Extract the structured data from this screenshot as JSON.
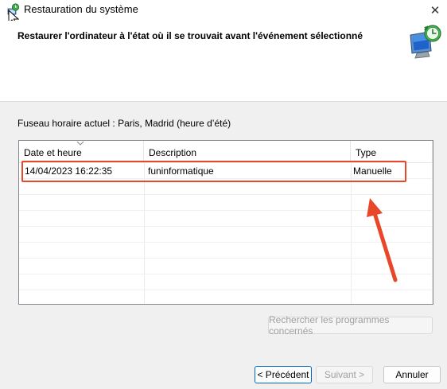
{
  "window": {
    "title": "Restauration du système"
  },
  "header": {
    "title": "Restaurer l'ordinateur à l'état où il se trouvait avant l'événement sélectionné"
  },
  "timezone_text": "Fuseau horaire actuel : Paris, Madrid (heure d’été)",
  "list": {
    "columns": [
      "Date et heure",
      "Description",
      "Type"
    ],
    "rows": [
      {
        "date": "14/04/2023 16:22:35",
        "description": "funinformatique",
        "type": "Manuelle"
      }
    ]
  },
  "buttons": {
    "scan": "Rechercher les programmes concernés",
    "back": "< Précédent",
    "next": "Suivant >",
    "cancel": "Annuler"
  },
  "colors": {
    "annotation": "#e8472a",
    "accent": "#0067c0"
  }
}
